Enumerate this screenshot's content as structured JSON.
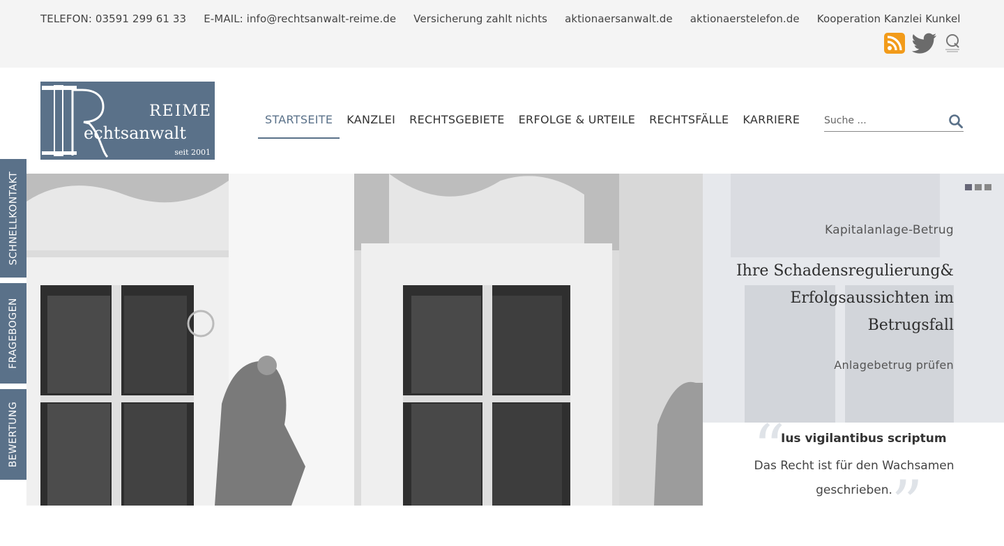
{
  "topbar": {
    "links": [
      "TELEFON: 03591 299 61 33",
      "E-MAIL: info@rechtsanwalt-reime.de",
      "Versicherung zahlt nichts",
      "aktionaersanwalt.de",
      "aktionaerstelefon.de",
      "Kooperation Kanzlei Kunkel"
    ]
  },
  "logo": {
    "top": "REIME",
    "main": "echtsanwalt",
    "since": "seit 2001"
  },
  "nav": {
    "items": [
      "STARTSEITE",
      "KANZLEI",
      "RECHTSGEBIETE",
      "ERFOLGE & URTEILE",
      "RECHTSFÄLLE",
      "KARRIERE"
    ]
  },
  "search": {
    "placeholder": "Suche ..."
  },
  "sidetabs": [
    "SCHNELLKONTAKT",
    "FRAGEBOGEN",
    "BEWERTUNG"
  ],
  "slider": {
    "kicker": "Kapitalanlage-Betrug",
    "headline": "Ihre Schadensregulierung& Erfolgsaussichten im Betrugsfall",
    "cta": "Anlagebetrug prüfen"
  },
  "quote": {
    "title": "Ius vigilantibus scriptum",
    "text": "Das Recht ist für den Wachsamen geschrieben."
  },
  "colors": {
    "accent": "#5a7189",
    "rss": "#f29b1a",
    "topbar": "#f4f4f4"
  },
  "icons": [
    "rss-icon",
    "twitter-icon",
    "q-badge-icon",
    "search-icon"
  ]
}
